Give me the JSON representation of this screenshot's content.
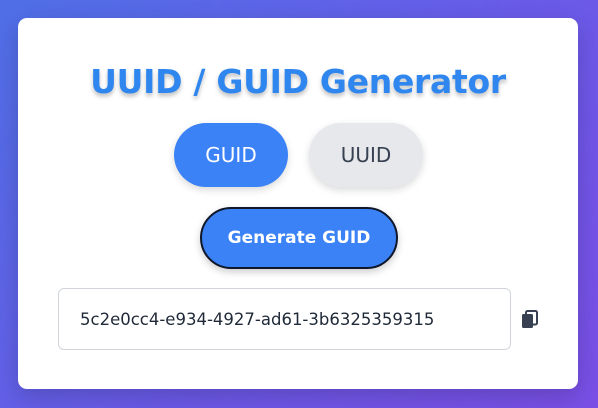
{
  "app": {
    "title": "UUID / GUID Generator"
  },
  "toggles": {
    "guid_label": "GUID",
    "uuid_label": "UUID",
    "selected": "GUID"
  },
  "actions": {
    "generate_label": "Generate GUID"
  },
  "output": {
    "value": "5c2e0cc4-e934-4927-ad61-3b6325359315",
    "copy_icon": "copy-icon"
  },
  "colors": {
    "accent": "#3b82f6",
    "title": "#2f86ee",
    "inactive_toggle": "#e6e8ec"
  }
}
